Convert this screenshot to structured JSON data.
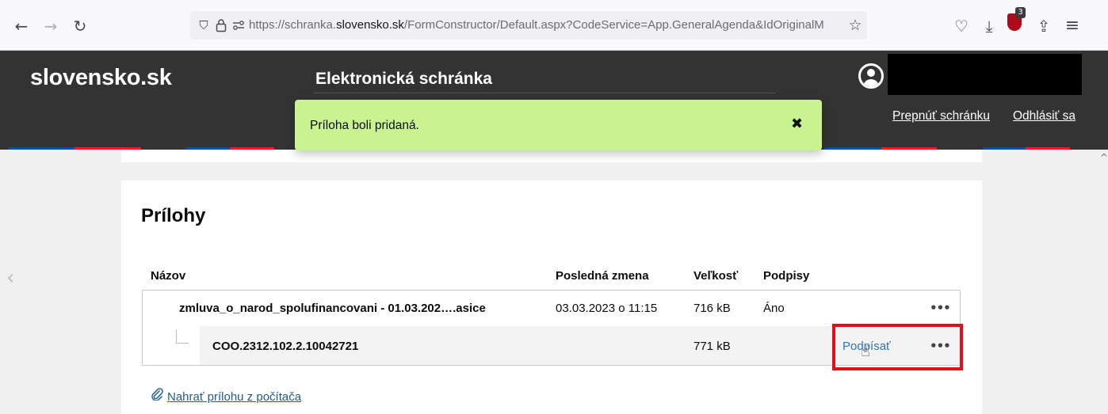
{
  "browser": {
    "back_icon": "←",
    "forward_icon": "→",
    "reload_icon": "↻",
    "url_prefix": "https://schranka.",
    "url_domain": "slovensko.sk",
    "url_path": "/FormConstructor/Default.aspx?CodeService=App.GeneralAgenda&IdOriginalM",
    "bookmark_icon": "☆",
    "pocket_icon": "♡",
    "download_icon": "⤓",
    "extension_badge": "3",
    "share_icon": "⇪",
    "menu_icon": "≡"
  },
  "site": {
    "logo": "slovensko.sk",
    "app_title": "Elektronická schránka",
    "switch_mailbox": "Prepnúť schránku",
    "logout": "Odhlásiť sa",
    "stripe_colors": [
      "#0b4ea2",
      "#ee1c25"
    ]
  },
  "toast": {
    "message": "Príloha boli pridaná.",
    "close": "✖",
    "color": "#c9f391"
  },
  "attachments": {
    "title": "Prílohy",
    "columns": {
      "name": "Názov",
      "modified": "Posledná zmena",
      "size": "Veľkosť",
      "signatures": "Podpisy"
    },
    "rows": [
      {
        "name": "zmluva_o_narod_spolufinancovani - 01.03.202….asice",
        "modified": "03.03.2023 o 11:15",
        "size": "716 kB",
        "signatures": "Áno",
        "more": "•••"
      },
      {
        "name": "COO.2312.102.2.10042721",
        "modified": "",
        "size": "771 kB",
        "action": "Podpísať",
        "more": "•••"
      }
    ],
    "upload_label": "Nahrať prílohu z počítača"
  },
  "nav": {
    "prev_icon": "‹",
    "scroll_up_icon": "^"
  }
}
